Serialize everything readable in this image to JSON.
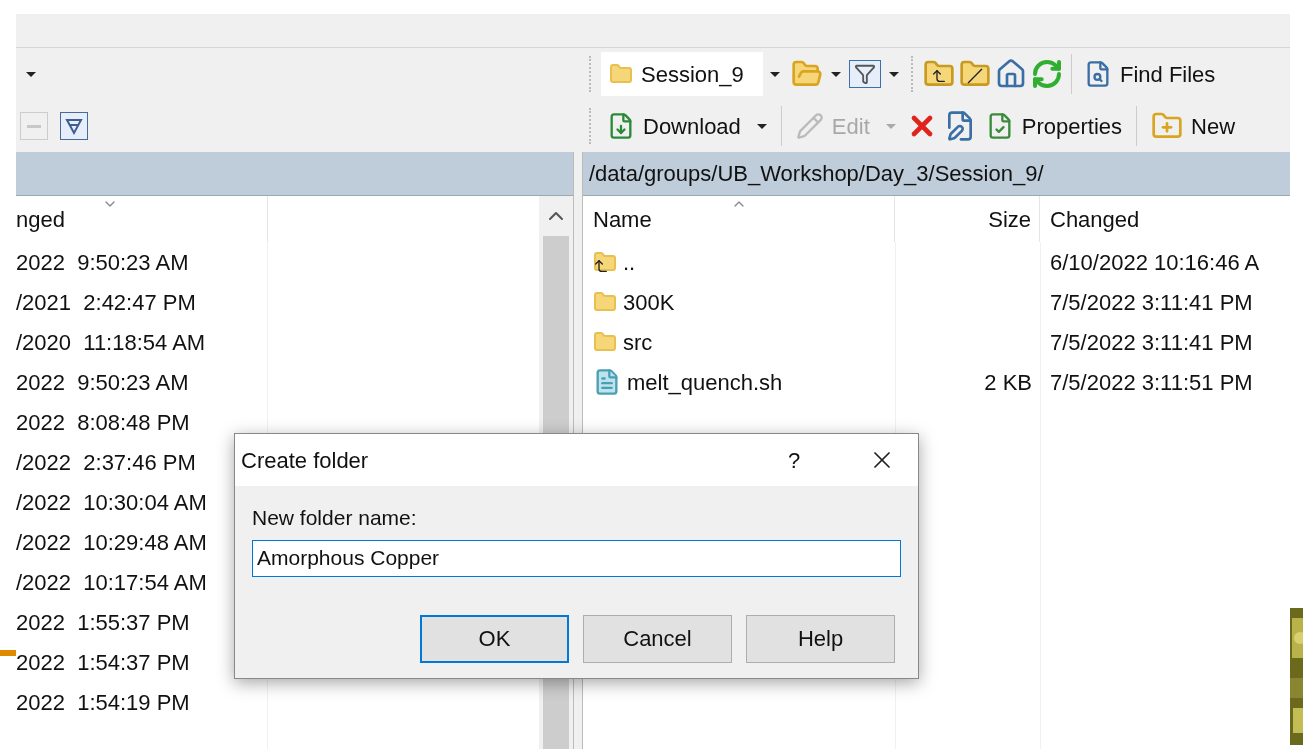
{
  "left_panel": {
    "columns": [
      "nged"
    ],
    "rows": [
      "2022  9:50:23 AM",
      "/2021  2:42:47 PM",
      "/2020  11:18:54 AM",
      "2022  9:50:23 AM",
      "2022  8:08:48 PM",
      "/2022  2:37:46 PM",
      "/2022  10:30:04 AM",
      "/2022  10:29:48 AM",
      "/2022  10:17:54 AM",
      "2022  1:55:37 PM",
      "2022  1:54:37 PM",
      "2022  1:54:19 PM"
    ]
  },
  "right_panel": {
    "session": "Session_9",
    "find_button": "Find Files",
    "actions": [
      {
        "kind": "download",
        "label": "Download",
        "disabled": false
      },
      {
        "kind": "edit",
        "label": "Edit",
        "disabled": true
      },
      {
        "kind": "delete",
        "disabled": false
      },
      {
        "kind": "rename",
        "disabled": false
      },
      {
        "kind": "properties",
        "label": "Properties",
        "disabled": false
      },
      {
        "kind": "new",
        "label": "New",
        "disabled": false
      }
    ],
    "path": "/data/groups/UB_Workshop/Day_3/Session_9/",
    "columns": [
      "Name",
      "Size",
      "Changed"
    ],
    "rows": [
      {
        "kind": "parent",
        "name": "..",
        "changed": "6/10/2022 10:16:46 A"
      },
      {
        "kind": "folder",
        "name": "300K",
        "changed": "7/5/2022 3:11:41 PM"
      },
      {
        "kind": "folder",
        "name": "src",
        "changed": "7/5/2022 3:11:41 PM"
      },
      {
        "kind": "file",
        "name": "melt_quench.sh",
        "size": "2 KB",
        "changed": "7/5/2022 3:11:51 PM"
      }
    ]
  },
  "dialog": {
    "title": "Create folder",
    "help": "?",
    "label": "New folder name:",
    "value": "Amorphous Copper",
    "buttons": [
      {
        "label": "OK",
        "default": true
      },
      {
        "label": "Cancel",
        "default": false
      },
      {
        "label": "Help",
        "default": false
      }
    ]
  }
}
